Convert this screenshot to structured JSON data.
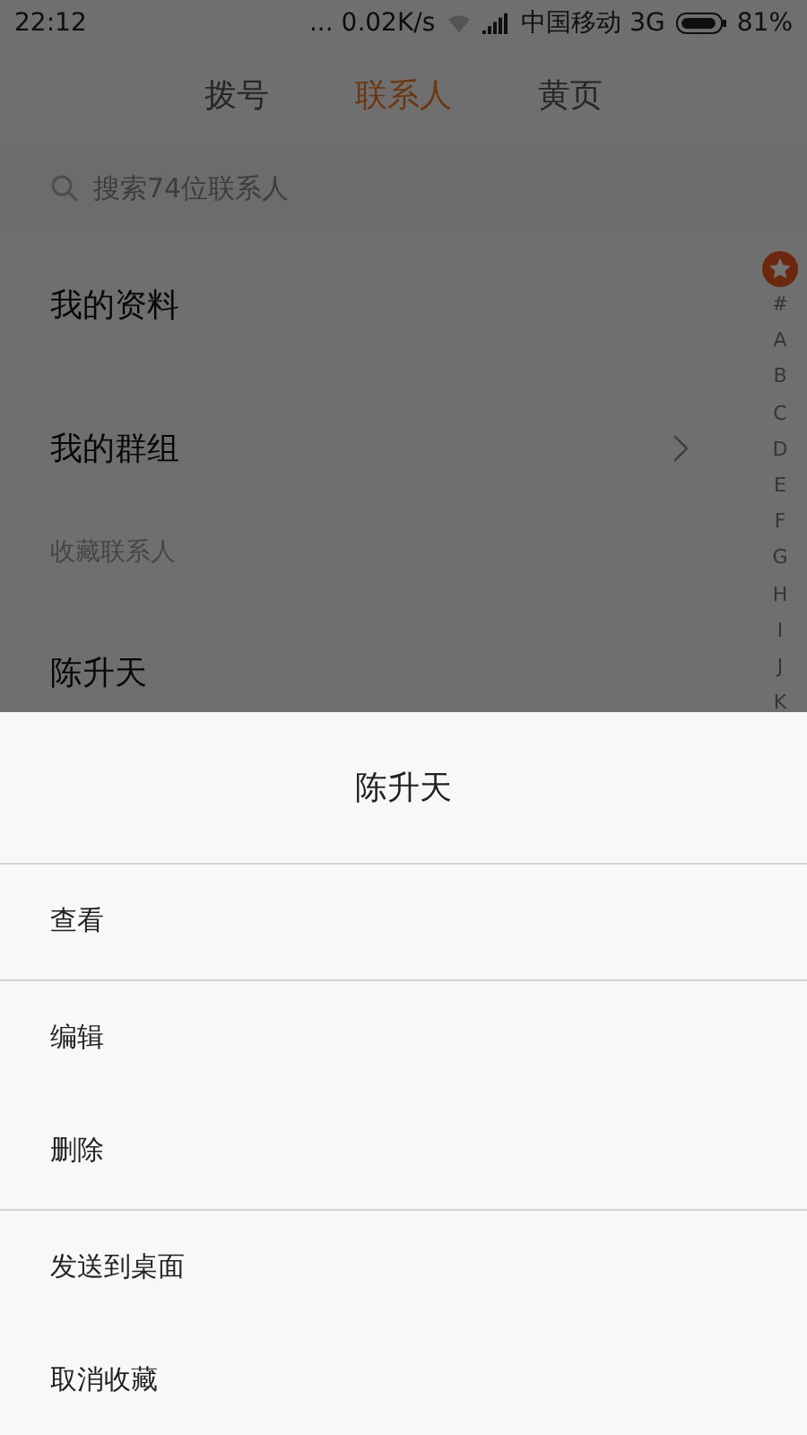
{
  "status_bar": {
    "time": "22:12",
    "network_speed": "... 0.02K/s",
    "carrier": "中国移动 3G",
    "battery": "81%"
  },
  "tabs": [
    {
      "label": "拨号",
      "selected": false
    },
    {
      "label": "联系人",
      "selected": true
    },
    {
      "label": "黄页",
      "selected": false
    }
  ],
  "search": {
    "placeholder": "搜索74位联系人"
  },
  "rows": [
    {
      "kind": "item",
      "label": "我的资料",
      "chevron": false
    },
    {
      "kind": "item",
      "label": "我的群组",
      "chevron": true
    },
    {
      "kind": "header",
      "label": "收藏联系人"
    },
    {
      "kind": "item",
      "label": "陈升天",
      "chevron": false
    }
  ],
  "index": [
    "#",
    "A",
    "B",
    "C",
    "D",
    "E",
    "F",
    "G",
    "H",
    "I",
    "J",
    "K"
  ],
  "sheet": {
    "title": "陈升天",
    "groups": [
      [
        "查看"
      ],
      [
        "编辑",
        "删除"
      ],
      [
        "发送到桌面",
        "取消收藏"
      ]
    ]
  }
}
